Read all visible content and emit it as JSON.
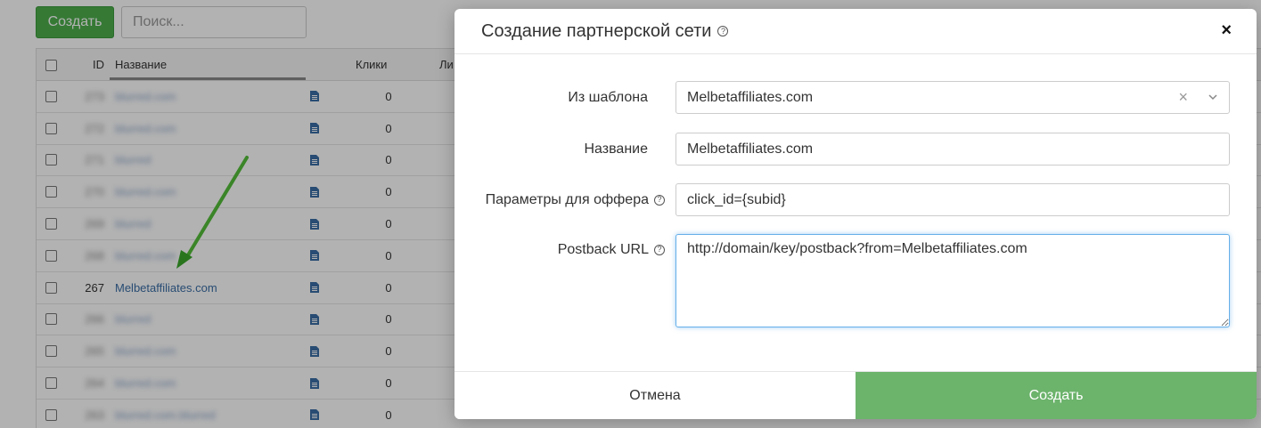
{
  "toolbar": {
    "create_label": "Создать",
    "search_placeholder": "Поиск..."
  },
  "table": {
    "headers": {
      "id": "ID",
      "name": "Название",
      "clicks": "Клики",
      "leads": "Ли"
    },
    "rows": [
      {
        "id": "273",
        "name": "blurred.com",
        "clicks": "0",
        "blurred": true
      },
      {
        "id": "272",
        "name": "blurred.com",
        "clicks": "0",
        "blurred": true
      },
      {
        "id": "271",
        "name": "blurred",
        "clicks": "0",
        "blurred": true
      },
      {
        "id": "270",
        "name": "blurred.com",
        "clicks": "0",
        "blurred": true
      },
      {
        "id": "269",
        "name": "blurred",
        "clicks": "0",
        "blurred": true
      },
      {
        "id": "268",
        "name": "blurred.com",
        "clicks": "0",
        "blurred": true
      },
      {
        "id": "267",
        "name": "Melbetaffiliates.com",
        "clicks": "0",
        "blurred": false
      },
      {
        "id": "266",
        "name": "blurred",
        "clicks": "0",
        "blurred": true
      },
      {
        "id": "265",
        "name": "blurred.com",
        "clicks": "0",
        "blurred": true
      },
      {
        "id": "264",
        "name": "blurred.com",
        "clicks": "0",
        "blurred": true
      },
      {
        "id": "263",
        "name": "blurred.com.blurred",
        "clicks": "0",
        "blurred": true
      }
    ]
  },
  "modal": {
    "title": "Создание партнерской сети",
    "close_icon": "×",
    "help_icon": "?",
    "fields": {
      "template": {
        "label": "Из шаблона",
        "value": "Melbetaffiliates.com",
        "clear": "×"
      },
      "name": {
        "label": "Название",
        "value": "Melbetaffiliates.com"
      },
      "offer_params": {
        "label": "Параметры для оффера",
        "value": "click_id={subid}"
      },
      "postback": {
        "label": "Postback URL",
        "value": "http://domain/key/postback?from=Melbetaffiliates.com"
      }
    },
    "footer": {
      "cancel_label": "Отмена",
      "submit_label": "Создать"
    }
  },
  "colors": {
    "accent_green": "#6cb36c",
    "focus_blue": "#66afe9",
    "link_blue": "#3a6ea5",
    "arrow_green": "#5dc33a"
  }
}
